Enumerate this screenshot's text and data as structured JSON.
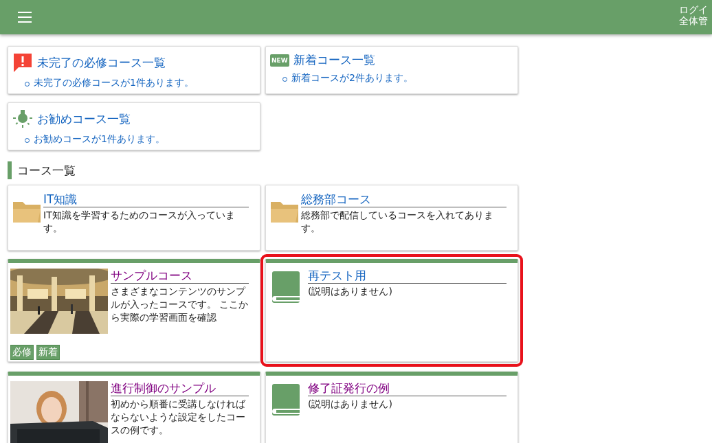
{
  "header": {
    "user_lines": [
      "ログイ",
      "全体管"
    ]
  },
  "summaries": [
    {
      "kind": "alert",
      "title": "未完了の必修コース一覧",
      "items": [
        "未完了の必修コースが1件あります。"
      ]
    },
    {
      "kind": "new",
      "badge": "NEW",
      "title": "新着コース一覧",
      "items": [
        "新着コースが2件あります。"
      ]
    },
    {
      "kind": "bulb",
      "title": "お勧めコース一覧",
      "items": [
        "お勧めコースが1件あります。"
      ]
    }
  ],
  "section_title": "コース一覧",
  "folders": [
    {
      "title": "IT知識",
      "description": "IT知識を学習するためのコースが入っています。"
    },
    {
      "title": "総務部コース",
      "description": "総務部で配信しているコースを入れてあります。"
    }
  ],
  "courses": [
    {
      "kind": "picture",
      "title": "サンプルコース",
      "visited": true,
      "highlighted": false,
      "description": "さまざまなコンテンツのサンプルが入ったコースです。 ここから実際の学習画面を確認",
      "tags": [
        "必修",
        "新着"
      ]
    },
    {
      "kind": "book",
      "title": "再テスト用",
      "visited": false,
      "highlighted": true,
      "description": "(説明はありません)"
    },
    {
      "kind": "picture",
      "title": "進行制御のサンプル",
      "visited": true,
      "highlighted": false,
      "description": "初めから順番に受講しなければならないような設定をしたコースの例です。"
    },
    {
      "kind": "book",
      "title": "修了証発行の例",
      "visited": true,
      "highlighted": false,
      "description": "(説明はありません)"
    }
  ]
}
